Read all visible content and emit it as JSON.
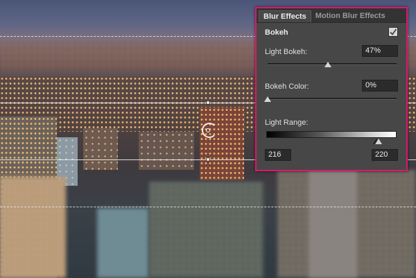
{
  "panel": {
    "tabs": [
      {
        "label": "Blur Effects",
        "active": true
      },
      {
        "label": "Motion Blur Effects",
        "active": false
      }
    ],
    "section_title": "Bokeh",
    "bokeh_enabled": true,
    "light_bokeh": {
      "label": "Light Bokeh:",
      "value": "47%",
      "level": 0.47
    },
    "bokeh_color": {
      "label": "Bokeh Color:",
      "value": "0%",
      "level": 0.0
    },
    "light_range": {
      "label": "Light Range:",
      "low": "216",
      "high": "220",
      "low_level": 216,
      "high_level": 220,
      "max": 255
    }
  },
  "colors": {
    "accent_border": "#e0156e",
    "panel_bg": "#474747",
    "tab_bar": "#333333"
  }
}
